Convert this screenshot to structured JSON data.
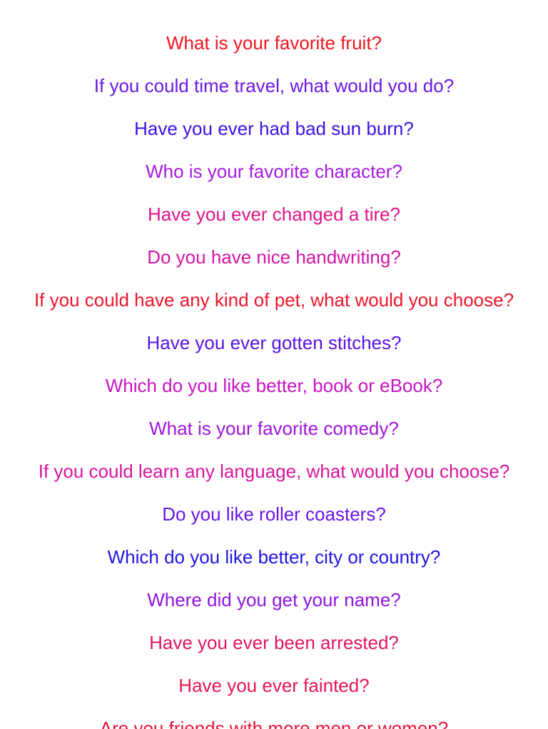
{
  "questions": [
    {
      "text": "What is your favorite fruit?",
      "color": "#f2141e"
    },
    {
      "text": "If you could time travel, what would you do?",
      "color": "#6a18e6"
    },
    {
      "text": "Have you ever had bad sun burn?",
      "color": "#3d10e8"
    },
    {
      "text": "Who is your favorite character?",
      "color": "#a61ae0"
    },
    {
      "text": "Have you ever changed a tire?",
      "color": "#e0148a"
    },
    {
      "text": "Do you have nice handwriting?",
      "color": "#d414a6"
    },
    {
      "text": "If you could have any kind of pet, what would you choose?",
      "color": "#f0142a"
    },
    {
      "text": "Have you ever gotten stitches?",
      "color": "#5a14e6"
    },
    {
      "text": "Which do you like better, book or eBook?",
      "color": "#c814c2"
    },
    {
      "text": "What is your favorite comedy?",
      "color": "#a014dc"
    },
    {
      "text": "If you could learn any language, what would you choose?",
      "color": "#d8149e"
    },
    {
      "text": "Do you like roller coasters?",
      "color": "#6a14e6"
    },
    {
      "text": "Which do you like better, city or country?",
      "color": "#2014e6"
    },
    {
      "text": "Where did you get your name?",
      "color": "#9014e0"
    },
    {
      "text": "Have you ever been arrested?",
      "color": "#e01464"
    },
    {
      "text": "Have you ever fainted?",
      "color": "#e81450"
    },
    {
      "text": "Are you friends with more men or women?",
      "color": "#e01438"
    }
  ]
}
